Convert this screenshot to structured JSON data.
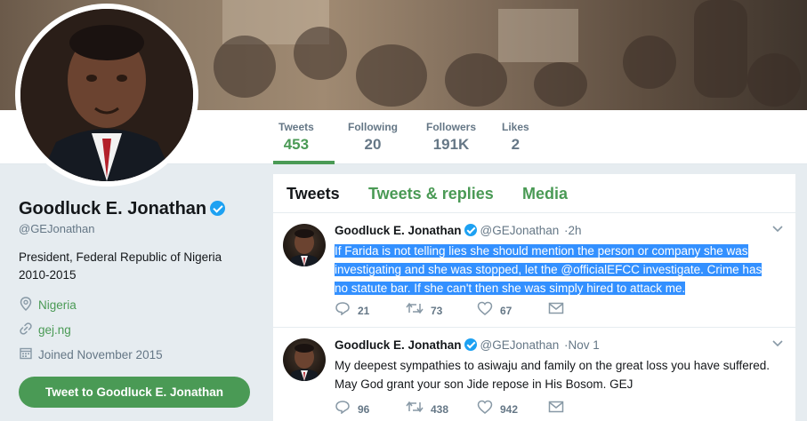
{
  "profile": {
    "name": "Goodluck E. Jonathan",
    "handle": "@GEJonathan",
    "bio": "President, Federal Republic of Nigeria 2010-2015",
    "location": "Nigeria",
    "website": "gej.ng",
    "joined": "Joined November 2015",
    "tweet_to_button": "Tweet to Goodluck E. Jonathan"
  },
  "stats": [
    {
      "label": "Tweets",
      "value": "453"
    },
    {
      "label": "Following",
      "value": "20"
    },
    {
      "label": "Followers",
      "value": "191K"
    },
    {
      "label": "Likes",
      "value": "2"
    }
  ],
  "tabs": [
    "Tweets",
    "Tweets & replies",
    "Media"
  ],
  "tweets": [
    {
      "name": "Goodluck E. Jonathan",
      "handle": "@GEJonathan",
      "time": "·2h",
      "lines": [
        "If Farida is not telling lies she should mention the person or company she was",
        "investigating and she was stopped, let the @officialEFCC investigate. Crime has",
        "no statute bar. If she can't then she was simply hired to attack me."
      ],
      "replies": "21",
      "retweets": "73",
      "likes": "67"
    },
    {
      "name": "Goodluck E. Jonathan",
      "handle": "@GEJonathan",
      "time": "·Nov 1",
      "lines": [
        "My deepest sympathies to asiwaju and family on the great loss you have suffered.",
        "May God grant your son Jide repose in His Bosom. GEJ"
      ],
      "replies": "96",
      "retweets": "438",
      "likes": "942"
    }
  ],
  "icons": {
    "location": "map-pin-icon",
    "link": "link-icon",
    "calendar": "calendar-icon",
    "reply": "reply-icon",
    "retweet": "retweet-icon",
    "like": "heart-icon",
    "message": "envelope-icon",
    "verified": "verified-badge-icon",
    "chevron": "chevron-down-icon"
  },
  "colors": {
    "accent": "#4a9a55",
    "verified": "#1da1f2",
    "selection": "#3390ff"
  }
}
